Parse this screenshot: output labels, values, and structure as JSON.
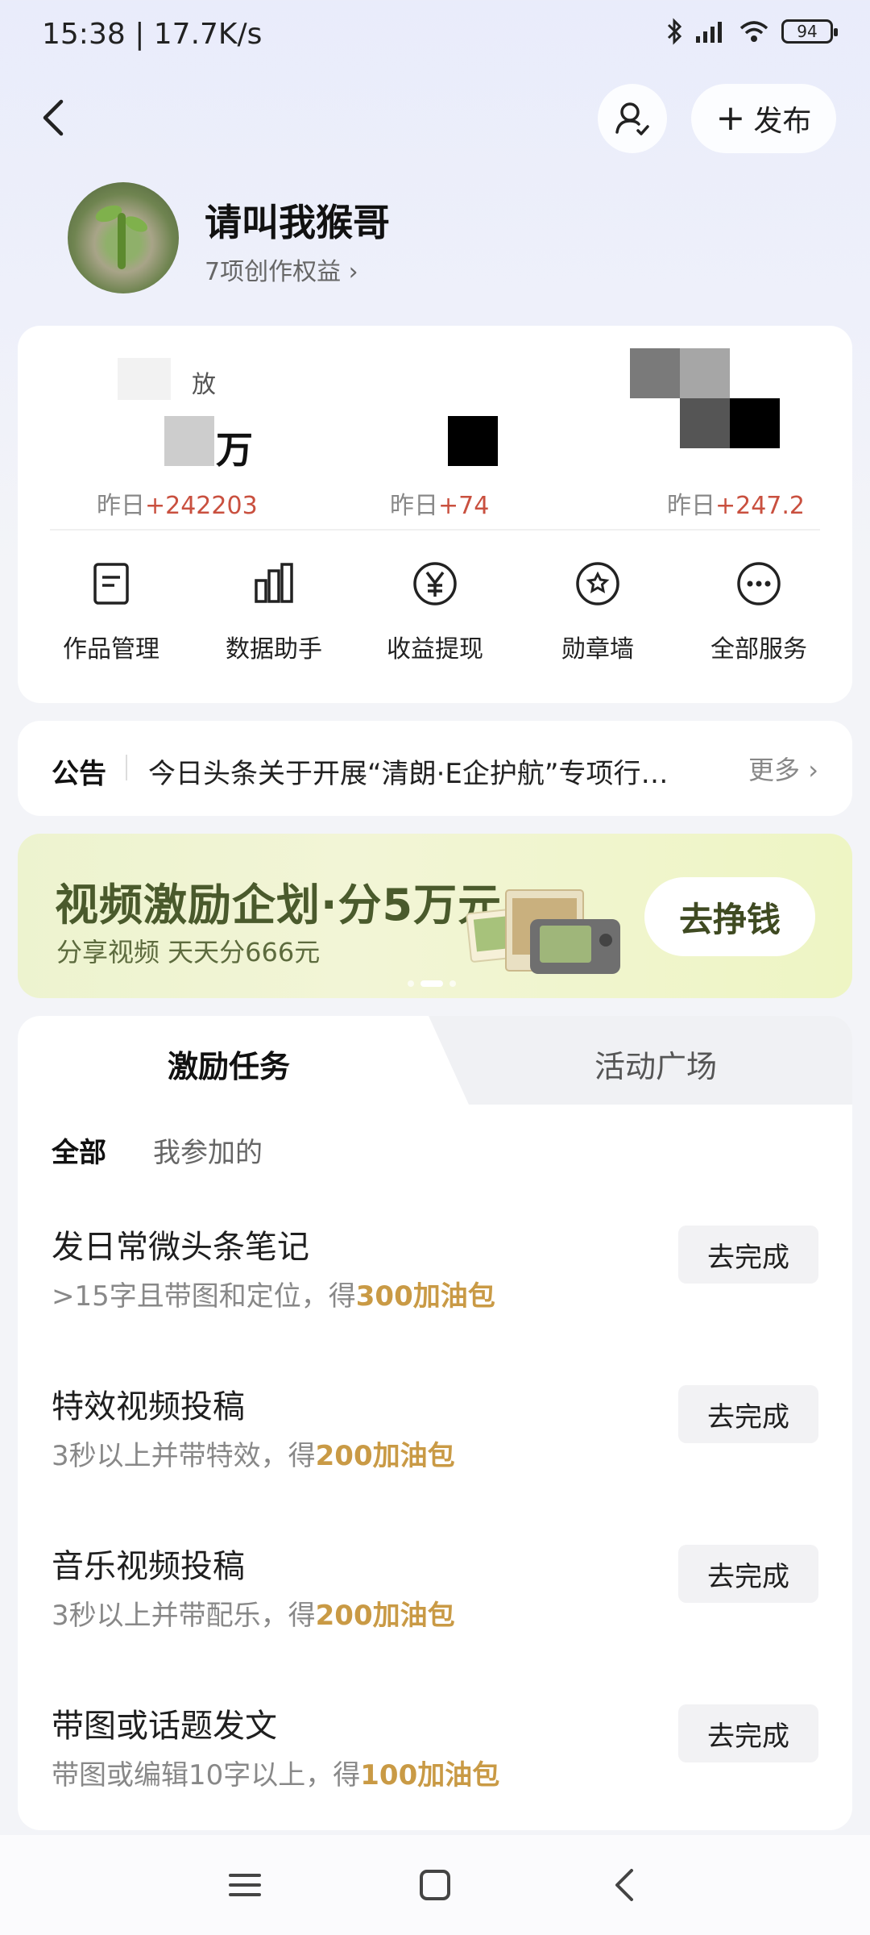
{
  "status_bar": {
    "time": "15:38 | 17.7K/s",
    "battery": "94"
  },
  "header": {
    "publish_label": "发布"
  },
  "profile": {
    "name": "请叫我猴哥",
    "rights": "7项创作权益"
  },
  "stats": [
    {
      "label_visible": "放",
      "value_visible": "万",
      "delta_prefix": "昨日",
      "delta_value": "+242203"
    },
    {
      "delta_prefix": "昨日",
      "delta_value": "+74"
    },
    {
      "delta_prefix": "昨日",
      "delta_value": "+247.2"
    }
  ],
  "services": [
    {
      "label": "作品管理",
      "icon": "document-icon"
    },
    {
      "label": "数据助手",
      "icon": "bar-chart-icon"
    },
    {
      "label": "收益提现",
      "icon": "yuan-icon"
    },
    {
      "label": "勋章墙",
      "icon": "medal-icon"
    },
    {
      "label": "全部服务",
      "icon": "more-icon"
    }
  ],
  "notice": {
    "tag": "公告",
    "text": "今日头条关于开展“清朗·E企护航”专项行…",
    "more": "更多"
  },
  "banner": {
    "title": "视频激励企划·分5万元",
    "subtitle": "分享视频 天天分666元",
    "button": "去挣钱"
  },
  "tabs": {
    "active": "激励任务",
    "inactive": "活动广场"
  },
  "filters": {
    "all": "全部",
    "mine": "我参加的"
  },
  "tasks": [
    {
      "name": "发日常微头条笔记",
      "desc": ">15字且带图和定位，得",
      "reward": "300加油包",
      "button": "去完成"
    },
    {
      "name": "特效视频投稿",
      "desc": "3秒以上并带特效，得",
      "reward": "200加油包",
      "button": "去完成"
    },
    {
      "name": "音乐视频投稿",
      "desc": "3秒以上并带配乐，得",
      "reward": "200加油包",
      "button": "去完成"
    },
    {
      "name": "带图或话题发文",
      "desc": "带图或编辑10字以上，得",
      "reward": "100加油包",
      "button": "去完成"
    }
  ],
  "colors": {
    "delta": "#c9503f",
    "reward": "#c99a45",
    "banner_text": "#4a5a2c"
  }
}
